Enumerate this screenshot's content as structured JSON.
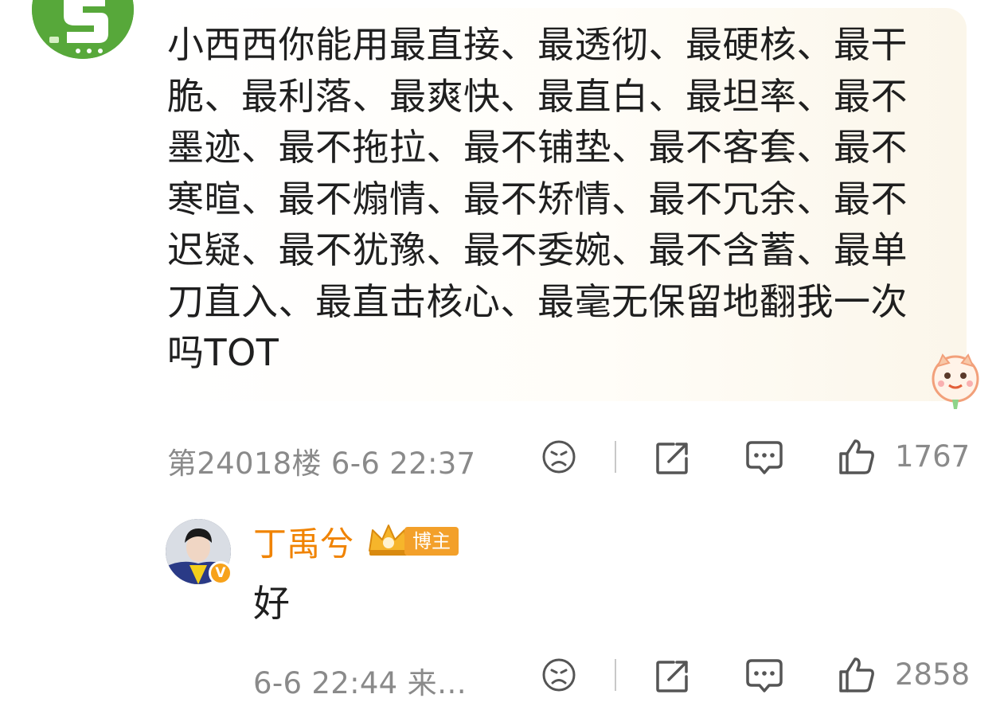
{
  "comment": {
    "text": "小西西你能用最直接、最透彻、最硬核、最干脆、最利落、最爽快、最直白、最坦率、最不墨迹、最不拖拉、最不铺垫、最不客套、最不寒暄、最不煽情、最不矫情、最不冗余、最不迟疑、最不犹豫、最不委婉、最不含蓄、最单刀直入、最直击核心、最毫无保留地翻我一次吗TOT",
    "floor_time": "第24018楼 6-6 22:37",
    "like_count": "1767"
  },
  "reply": {
    "author": "丁禹兮",
    "tag": "博主",
    "text": "好",
    "time_source": "6-6 22:44 来…",
    "like_count": "2858"
  },
  "icons": {
    "avatar_logo": "green-logo-avatar",
    "sticker": "cat-sticker-icon",
    "dislike": "sad-face-icon",
    "share": "share-icon",
    "comment": "comment-icon",
    "like": "thumbs-up-icon",
    "verified": "verified-badge-icon",
    "crown": "crown-icon"
  },
  "colors": {
    "author_name": "#f08300",
    "meta_gray": "#8a8a8a",
    "tag_bg": "#f3a02a",
    "logo_green": "#57a83a"
  }
}
